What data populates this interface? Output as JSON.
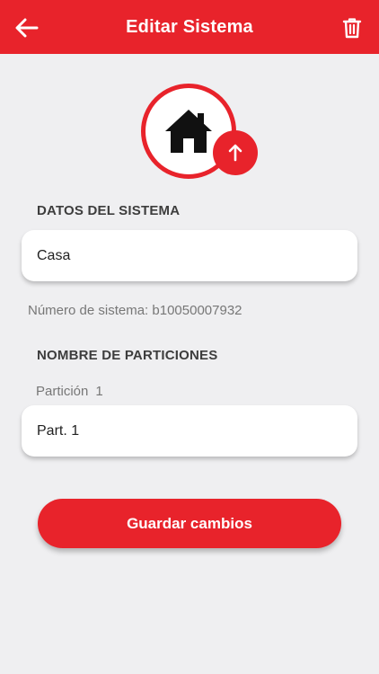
{
  "header": {
    "title": "Editar Sistema",
    "back_icon": "arrow-left-icon",
    "delete_icon": "trash-icon"
  },
  "avatar": {
    "icon": "house-icon",
    "upload_icon": "arrow-up-icon"
  },
  "system": {
    "section_title": "DATOS DEL SISTEMA",
    "name_value": "Casa",
    "number_label": "Número de sistema:",
    "number_value": "b10050007932"
  },
  "partitions": {
    "section_title": "NOMBRE DE PARTICIONES",
    "items": [
      {
        "label": "Partición",
        "index": "1",
        "value": "Part. 1"
      }
    ]
  },
  "actions": {
    "save_label": "Guardar cambios"
  },
  "colors": {
    "accent": "#e8232b",
    "background": "#efeff1"
  }
}
